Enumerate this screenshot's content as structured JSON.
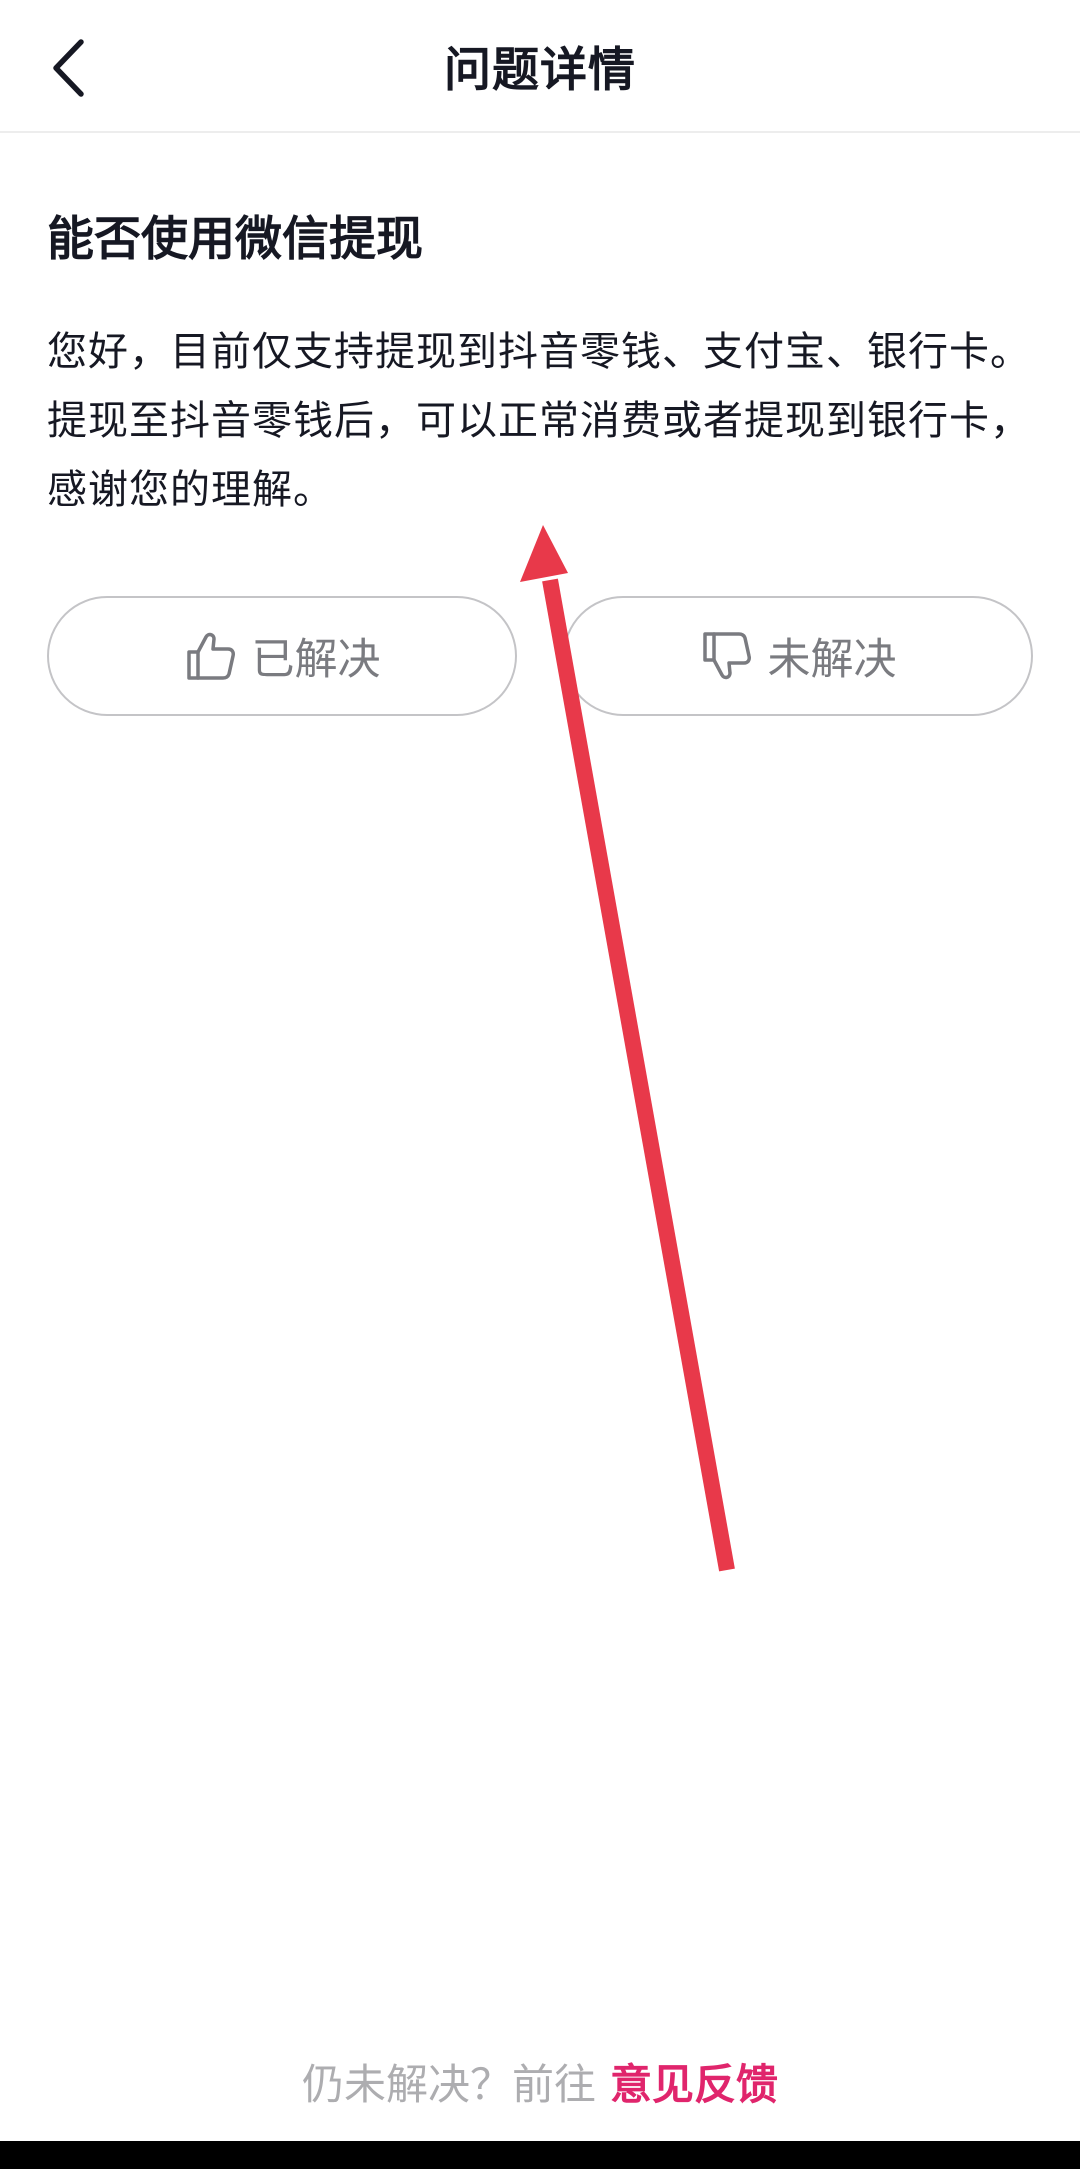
{
  "header": {
    "title": "问题详情",
    "back_icon": "chevron-left-icon"
  },
  "question": {
    "title": "能否使用微信提现",
    "answer": "您好，目前仅支持提现到抖音零钱、支付宝、银行卡。提现至抖音零钱后，可以正常消费或者提现到银行卡，感谢您的理解。"
  },
  "feedback_buttons": {
    "solved_label": "已解决",
    "solved_icon": "thumbs-up-icon",
    "unsolved_label": "未解决",
    "unsolved_icon": "thumbs-down-icon"
  },
  "footer": {
    "prompt": "仍未解决？前往",
    "link": "意见反馈",
    "link_color": "#e0256c"
  },
  "colors": {
    "text_primary": "#161823",
    "text_secondary": "#7a7b80",
    "annotation_arrow": "#e8394a"
  }
}
